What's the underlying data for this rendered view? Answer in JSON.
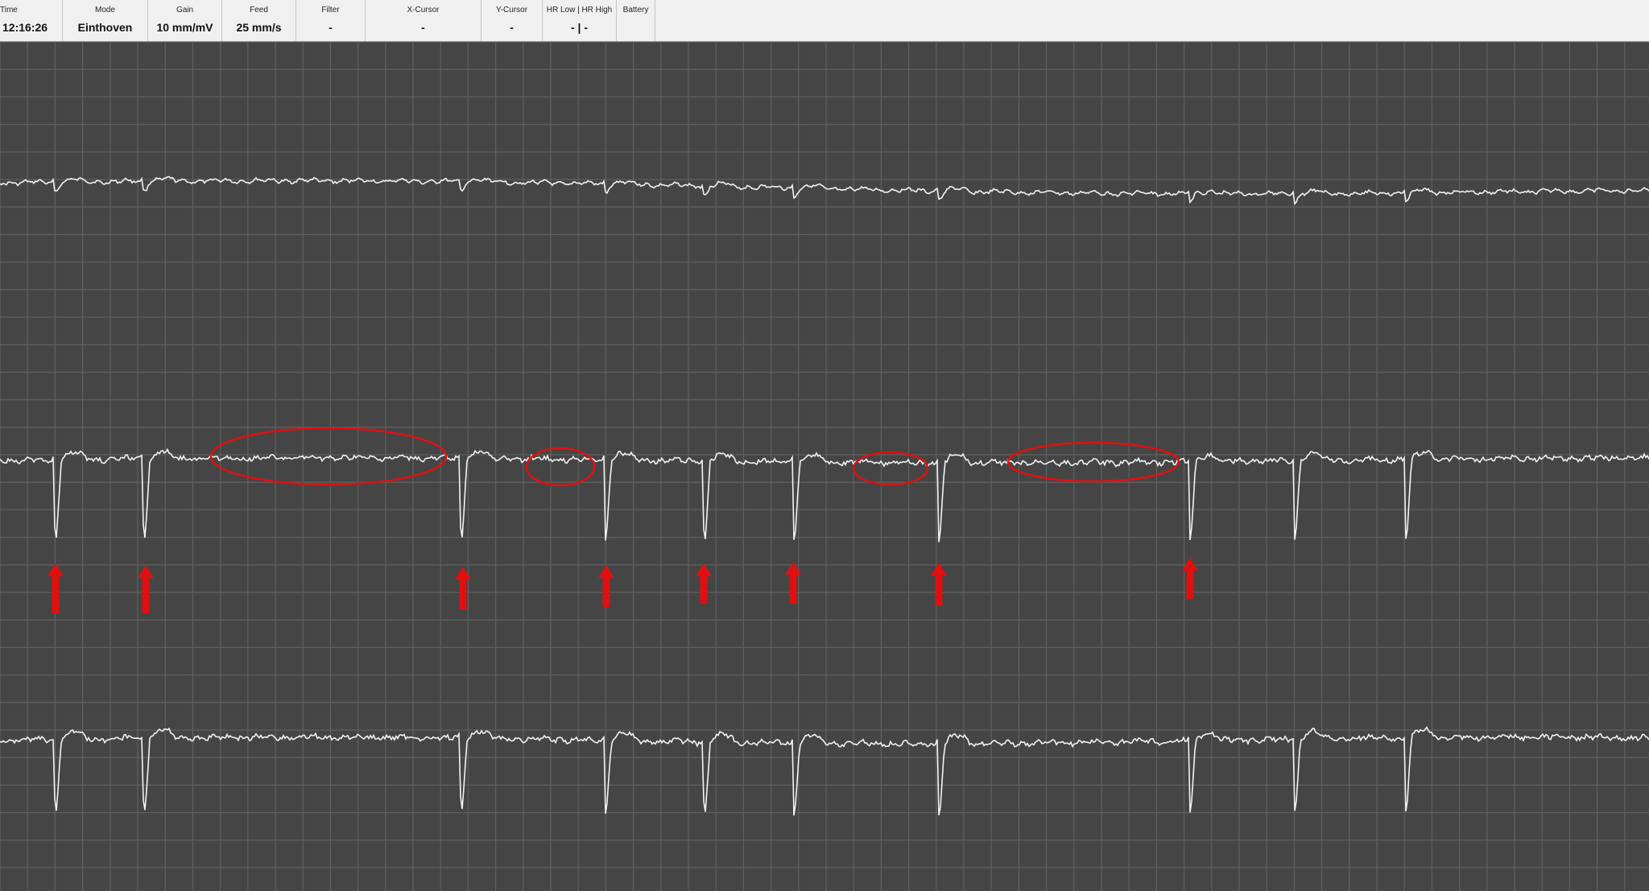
{
  "status_bar": {
    "time": {
      "label": "Time",
      "value": "12:16:26"
    },
    "mode": {
      "label": "Mode",
      "value": "Einthoven"
    },
    "gain": {
      "label": "Gain",
      "value": "10 mm/mV"
    },
    "feed": {
      "label": "Feed",
      "value": "25 mm/s"
    },
    "filter": {
      "label": "Filter",
      "value": "-"
    },
    "x_cursor": {
      "label": "X-Cursor",
      "value": "-"
    },
    "y_cursor": {
      "label": "Y-Cursor",
      "value": "-"
    },
    "hr": {
      "label": "HR Low | HR High",
      "value": "- | -"
    },
    "battery": {
      "label": "Battery",
      "value": ""
    }
  },
  "colors": {
    "background": "#454545",
    "grid": "#5f5f5f",
    "trace": "#f2f2f2",
    "annotation": "#e01010",
    "status_bg": "#f0f0f0"
  },
  "icons": {
    "arrow": "red-up-arrow-icon",
    "ellipse": "red-ellipse-annotation"
  },
  "annotations": {
    "arrow_count": 8,
    "ellipse_count": 4
  }
}
